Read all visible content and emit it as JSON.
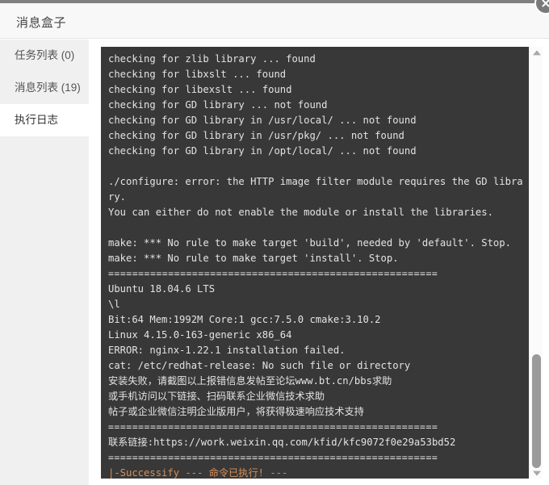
{
  "window": {
    "title": "消息盒子",
    "close_label": "×"
  },
  "sidebar": {
    "items": [
      {
        "label": "任务列表 (0)",
        "name": "sidebar-item-task-list",
        "active": false
      },
      {
        "label": "消息列表 (19)",
        "name": "sidebar-item-message-list",
        "active": false
      },
      {
        "label": "执行日志",
        "name": "sidebar-item-execution-log",
        "active": true
      }
    ]
  },
  "terminal": {
    "lines": [
      {
        "text": "checking for zlib library ... found",
        "style": ""
      },
      {
        "text": "checking for libxslt ... found",
        "style": ""
      },
      {
        "text": "checking for libexslt ... found",
        "style": ""
      },
      {
        "text": "checking for GD library ... not found",
        "style": ""
      },
      {
        "text": "checking for GD library in /usr/local/ ... not found",
        "style": ""
      },
      {
        "text": "checking for GD library in /usr/pkg/ ... not found",
        "style": ""
      },
      {
        "text": "checking for GD library in /opt/local/ ... not found",
        "style": ""
      },
      {
        "text": " ",
        "style": "blank"
      },
      {
        "text": "./configure: error: the HTTP image filter module requires the GD libra",
        "style": ""
      },
      {
        "text": "ry.",
        "style": ""
      },
      {
        "text": "You can either do not enable the module or install the libraries.",
        "style": ""
      },
      {
        "text": " ",
        "style": "blank"
      },
      {
        "text": "make: *** No rule to make target 'build', needed by 'default'. Stop.",
        "style": ""
      },
      {
        "text": "make: *** No rule to make target 'install'. Stop.",
        "style": ""
      },
      {
        "text": "=======================================================",
        "style": "sep"
      },
      {
        "text": "Ubuntu 18.04.6 LTS",
        "style": ""
      },
      {
        "text": "\\l",
        "style": ""
      },
      {
        "text": "Bit:64 Mem:1992M Core:1 gcc:7.5.0 cmake:3.10.2",
        "style": ""
      },
      {
        "text": "Linux 4.15.0-163-generic x86_64",
        "style": ""
      },
      {
        "text": "ERROR: nginx-1.22.1 installation failed.",
        "style": ""
      },
      {
        "text": "cat: /etc/redhat-release: No such file or directory",
        "style": ""
      },
      {
        "text": "安装失败，请截图以上报错信息发帖至论坛www.bt.cn/bbs求助",
        "style": ""
      },
      {
        "text": "或手机访问以下链接、扫码联系企业微信技术求助",
        "style": ""
      },
      {
        "text": "帖子或企业微信注明企业版用户，将获得极速响应技术支持",
        "style": ""
      },
      {
        "text": "=======================================================",
        "style": "sep"
      },
      {
        "text": "联系链接:https://work.weixin.qq.com/kfid/kfc9072f0e29a53bd52",
        "style": ""
      },
      {
        "text": "=======================================================",
        "style": "sep"
      },
      {
        "text": "|-Successify --- 命令已执行! ---",
        "style": "orange"
      }
    ]
  },
  "scrollbar": {
    "up_arrow": "scroll-up",
    "down_arrow": "scroll-down"
  },
  "colors": {
    "terminal_bg": "#383838",
    "terminal_fg": "#e3e3e3",
    "accent_orange": "#d98f5a",
    "sidebar_bg": "#f0f0f0",
    "header_bg": "#f8f8f8"
  }
}
